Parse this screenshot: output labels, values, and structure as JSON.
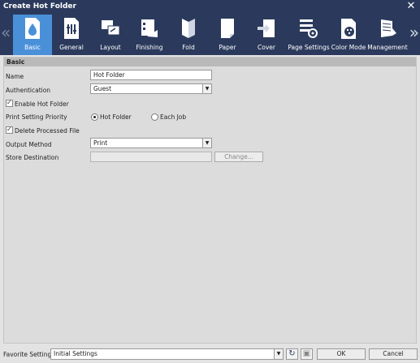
{
  "window": {
    "title": "Create Hot Folder"
  },
  "tabs": [
    {
      "label": "Basic",
      "icon": "basic-icon"
    },
    {
      "label": "General",
      "icon": "general-icon"
    },
    {
      "label": "Layout",
      "icon": "layout-icon"
    },
    {
      "label": "Finishing",
      "icon": "finishing-icon"
    },
    {
      "label": "Fold",
      "icon": "fold-icon"
    },
    {
      "label": "Paper",
      "icon": "paper-icon"
    },
    {
      "label": "Cover",
      "icon": "cover-icon"
    },
    {
      "label": "Page Settings",
      "icon": "page-settings-icon"
    },
    {
      "label": "Color Mode",
      "icon": "color-mode-icon"
    },
    {
      "label": "Management",
      "icon": "management-icon"
    }
  ],
  "section": {
    "title": "Basic"
  },
  "form": {
    "name_label": "Name",
    "name_value": "Hot Folder",
    "auth_label": "Authentication",
    "auth_value": "Guest",
    "enable_label": "Enable Hot Folder",
    "priority_label": "Print Setting Priority",
    "priority_opt1": "Hot Folder",
    "priority_opt2": "Each Job",
    "delete_label": "Delete Processed File",
    "output_label": "Output Method",
    "output_value": "Print",
    "store_label": "Store Destination",
    "store_value": "",
    "change_label": "Change..."
  },
  "footer": {
    "favorite_label": "Favorite Setting",
    "favorite_value": "Initial Settings",
    "ok_label": "OK",
    "cancel_label": "Cancel"
  },
  "colors": {
    "titlebar": "#2b3a5c",
    "active_tab": "#4a90d9"
  }
}
